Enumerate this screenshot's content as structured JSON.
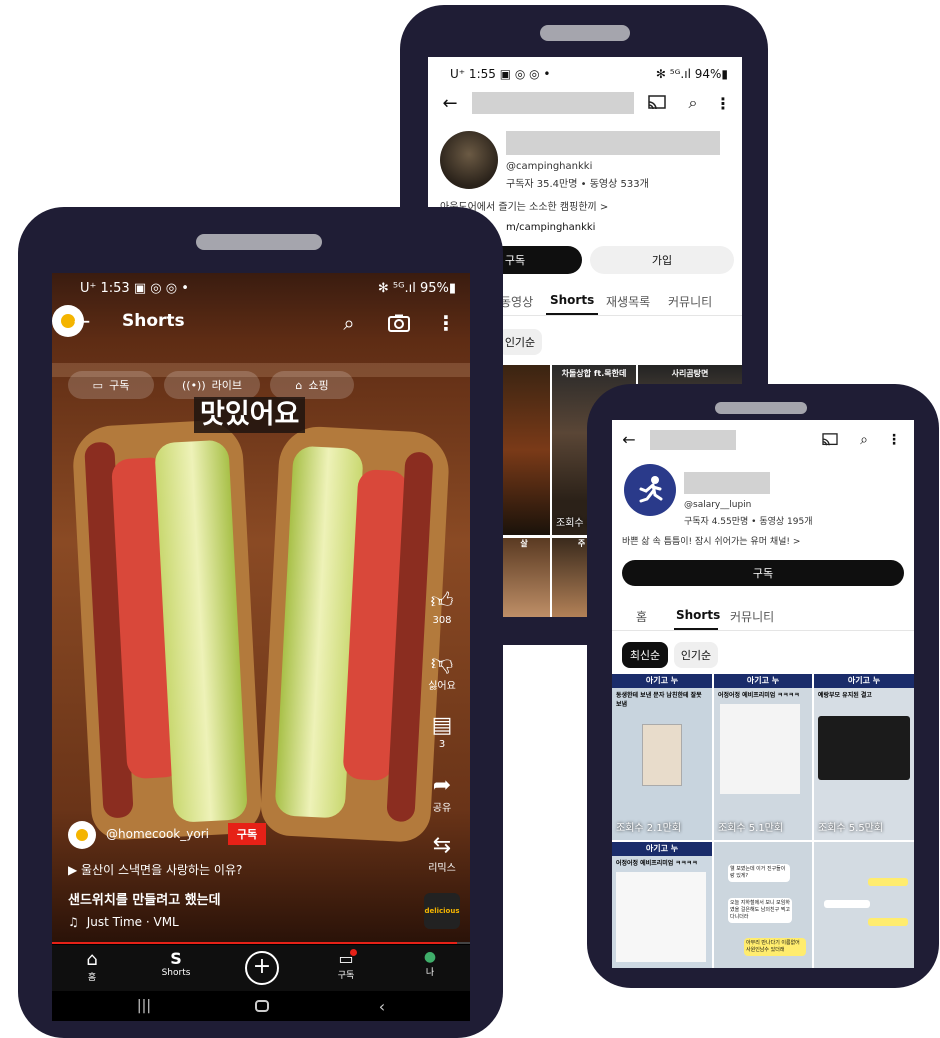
{
  "camping": {
    "status_left": "U⁺ 1:55 ▣ ◎ ◎ •",
    "status_right": "✻ ⁵ᴳ.ıl 94%▮",
    "handle": "@campinghankki",
    "stats": "구독자 35.4만명 • 동영상 533개",
    "desc": "아웃도어에서 즐기는 소소한 캠핑한끼  >",
    "link": "m/campinghankki",
    "subscribe_label": "구독",
    "join_label": "가입",
    "tabs": [
      "동영상",
      "Shorts",
      "재생목록",
      "커뮤니티"
    ],
    "chip": "인기순",
    "thumb_titles": [
      "차돌상합 ft.목한데",
      "사리곰탕면"
    ],
    "view_label": "조회수 2.7만",
    "thumb_bottom": [
      "살",
      "주 가리비"
    ]
  },
  "lupin": {
    "handle": "@salary__lupin",
    "stats": "구독자 4.55만명 • 동영상 195개",
    "desc": "바쁜 삶 속 틈틈이! 잠시 쉬어가는 유머 채널!  >",
    "subscribe_label": "구독",
    "tabs": [
      "홈",
      "Shorts",
      "커뮤니티"
    ],
    "chips": [
      "최신순",
      "인기순"
    ],
    "thumbs": [
      {
        "banner": "아기고 누",
        "title": "동생한테 보낸 문자 남친한테 잘못 보냄",
        "views": "조회수 2.1만회"
      },
      {
        "banner": "아기고 누",
        "title": "어정어정 에비프리미엄 ㅋㅋㅋㅋ",
        "views": "조회수 5.1만회"
      },
      {
        "banner": "아기고 누",
        "title": "예랑부모 유지된 결고",
        "views": "조회수 5.5만회"
      },
      {
        "banner": "아기고 누",
        "title": "어정어정 에비프리미엄 ㅋㅋㅋㅋ",
        "views": ""
      },
      {
        "banner": "",
        "title": "",
        "views": ""
      },
      {
        "banner": "",
        "title": "",
        "views": ""
      }
    ],
    "chat_bubbles": [
      "웰 보였는데 이거 진구들이랑 있게?",
      "오늘 지하철에서 보니 모임하였을 걸은해도 남의친구 찍고 다니더라",
      "아무리 만나다기 이름없어 사원인남수 있더래"
    ]
  },
  "shorts": {
    "status_left": "U⁺ 1:53 ▣ ◎ ◎ •",
    "status_right": "✻ ⁵ᴳ.ıl 95%▮",
    "header_title": "Shorts",
    "pills": [
      {
        "icon": "▭",
        "label": "구독"
      },
      {
        "icon": "((•))",
        "label": "라이브"
      },
      {
        "icon": "⌂",
        "label": "쇼핑"
      }
    ],
    "caption": "맛있어요",
    "likes": "308",
    "dislike_label": "싫어요",
    "comments": "3",
    "share_label": "공유",
    "remix_label": "리믹스",
    "channel": "@homecook_yori",
    "subscribe_label": "구독",
    "related": "▶  울산이 스낵면을 사랑하는 이유?",
    "title": "샌드위치를 만들려고 했는데",
    "music": "Just Time · VML",
    "channel_logo_text": "delicious",
    "nav": [
      {
        "icon": "⌂",
        "label": "홈"
      },
      {
        "icon": "S",
        "label": "Shorts"
      },
      {
        "icon": "+",
        "label": ""
      },
      {
        "icon": "▭",
        "label": "구독"
      },
      {
        "icon": "●",
        "label": "나"
      }
    ],
    "progress_pct": 97
  }
}
